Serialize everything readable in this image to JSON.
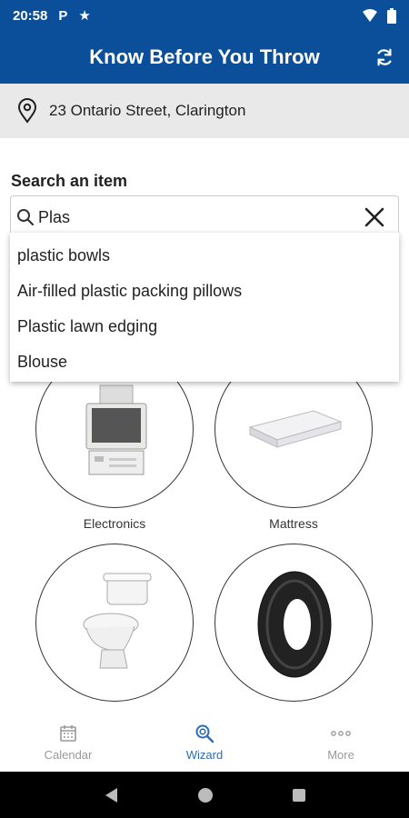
{
  "status_bar": {
    "time": "20:58",
    "icons": [
      "parking-icon",
      "star-icon",
      "wifi-icon",
      "battery-icon"
    ]
  },
  "app_bar": {
    "title": "Know Before You Throw",
    "action_icon": "refresh-icon"
  },
  "address": {
    "icon": "location-pin-icon",
    "text": "23 Ontario Street, Clarington"
  },
  "search": {
    "label": "Search an item",
    "value": "Plas",
    "clear_icon": "close-icon",
    "suggestions": [
      "plastic bowls",
      "Air-filled plastic packing pillows",
      "Plastic lawn edging",
      "Blouse"
    ]
  },
  "categories": [
    {
      "label": "Electronics",
      "image": "electronics-image"
    },
    {
      "label": "Mattress",
      "image": "mattress-image"
    },
    {
      "label": "",
      "image": "toilet-image"
    },
    {
      "label": "",
      "image": "tire-image"
    }
  ],
  "bottom_nav": {
    "items": [
      {
        "label": "Calendar",
        "icon": "calendar-icon",
        "active": false
      },
      {
        "label": "Wizard",
        "icon": "wizard-search-icon",
        "active": true
      },
      {
        "label": "More",
        "icon": "more-dots-icon",
        "active": false
      }
    ]
  },
  "colors": {
    "brand": "#0b4f9a",
    "active_nav": "#2c6cb5",
    "inactive_nav": "#999999",
    "address_bg": "#e9e9e9"
  }
}
